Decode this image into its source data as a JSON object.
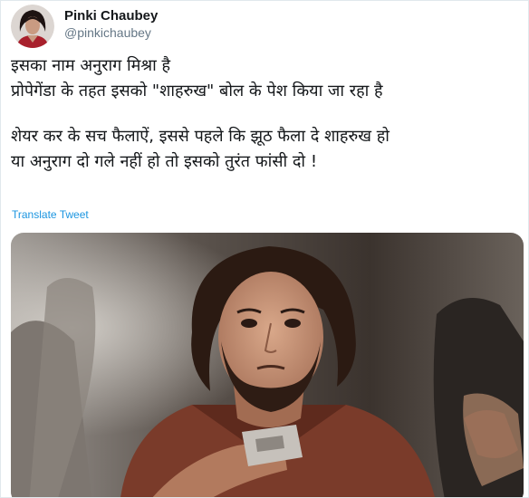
{
  "tweet": {
    "author": {
      "display_name": "Pinki Chaubey",
      "handle": "@pinkichaubey"
    },
    "text_lines": [
      "इसका नाम अनुराग मिश्रा है",
      "प्रोपेगेंडा के तहत इसको \"शाहरुख\" बोल के पेश किया जा रहा है",
      "शेयर कर के सच फैलाऐं, इससे पहले कि झूठ फैला दे शाहरुख हो",
      "या अनुराग दो गले नहीं हो तो इसको तुरंत फांसी दो !"
    ],
    "translate_label": "Translate Tweet"
  },
  "colors": {
    "name": "#14171a",
    "handle": "#657786",
    "link": "#1b95e0",
    "border": "#e1e8ed"
  }
}
